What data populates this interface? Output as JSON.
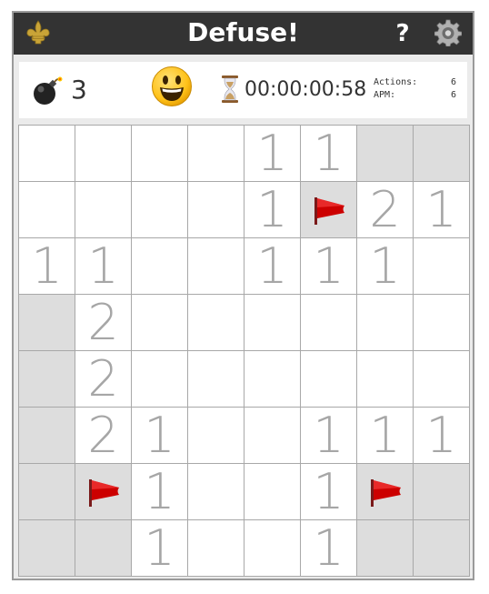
{
  "header": {
    "title": "Defuse!",
    "help_label": "?",
    "logo_icon": "fleur-de-lis-icon",
    "settings_icon": "gear-icon",
    "bar_color": "#333333"
  },
  "status": {
    "bomb_icon": "bomb-icon",
    "mines_remaining": "3",
    "face_icon": "smiley-face-icon",
    "timer_icon": "hourglass-icon",
    "timer": "00:00:00:58",
    "actions_label": "Actions:",
    "actions_value": "6",
    "apm_label": "APM:",
    "apm_value": "6"
  },
  "board": {
    "rows": 8,
    "cols": 8,
    "number_color": "#a6a6a6",
    "covered_color": "#dddddd",
    "flag_color": "#cc0000",
    "legend": "'' = revealed empty, '#' = covered, 'F' = flagged, digits = adjacent mine count",
    "cells": [
      [
        "",
        "",
        "",
        "",
        "1",
        "1",
        "#",
        "#"
      ],
      [
        "",
        "",
        "",
        "",
        "1",
        "F",
        "2",
        "1"
      ],
      [
        "1",
        "1",
        "",
        "",
        "1",
        "1",
        "1",
        ""
      ],
      [
        "#",
        "2",
        "",
        "",
        "",
        "",
        "",
        ""
      ],
      [
        "#",
        "2",
        "",
        "",
        "",
        "",
        "",
        ""
      ],
      [
        "#",
        "2",
        "1",
        "",
        "",
        "1",
        "1",
        "1"
      ],
      [
        "#",
        "F",
        "1",
        "",
        "",
        "1",
        "F",
        "#"
      ],
      [
        "#",
        "#",
        "1",
        "",
        "",
        "1",
        "#",
        "#"
      ]
    ]
  }
}
